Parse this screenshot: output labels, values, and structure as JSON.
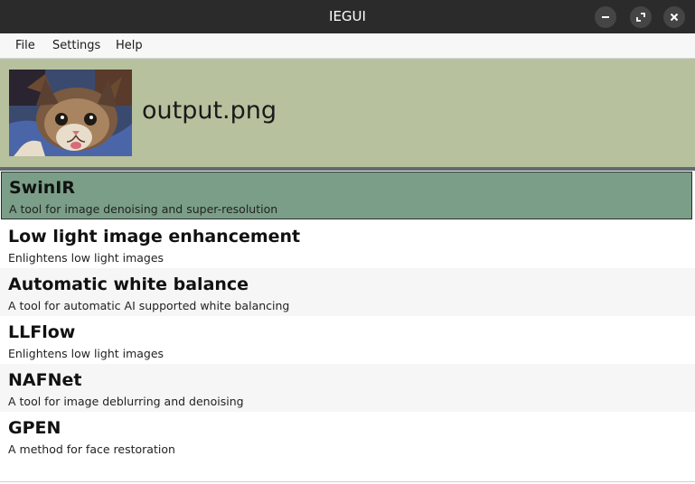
{
  "window": {
    "title": "IEGUI"
  },
  "menu": {
    "file": "File",
    "settings": "Settings",
    "help": "Help"
  },
  "header": {
    "filename": "output.png"
  },
  "tools": [
    {
      "name": "SwinIR",
      "description": "A tool for image denoising and super-resolution",
      "selected": true
    },
    {
      "name": "Low light image enhancement",
      "description": "Enlightens low light images",
      "selected": false
    },
    {
      "name": "Automatic white balance",
      "description": "A tool for automatic AI supported white balancing",
      "selected": false
    },
    {
      "name": "LLFlow",
      "description": "Enlightens low light images",
      "selected": false
    },
    {
      "name": "NAFNet",
      "description": "A tool for image deblurring and denoising",
      "selected": false
    },
    {
      "name": "GPEN",
      "description": "A method for face restoration",
      "selected": false
    }
  ],
  "colors": {
    "titlebar": "#2b2b2b",
    "header_bg": "#b8c19e",
    "selected_row": "#7a9e87",
    "divider": "#5f6b70"
  }
}
